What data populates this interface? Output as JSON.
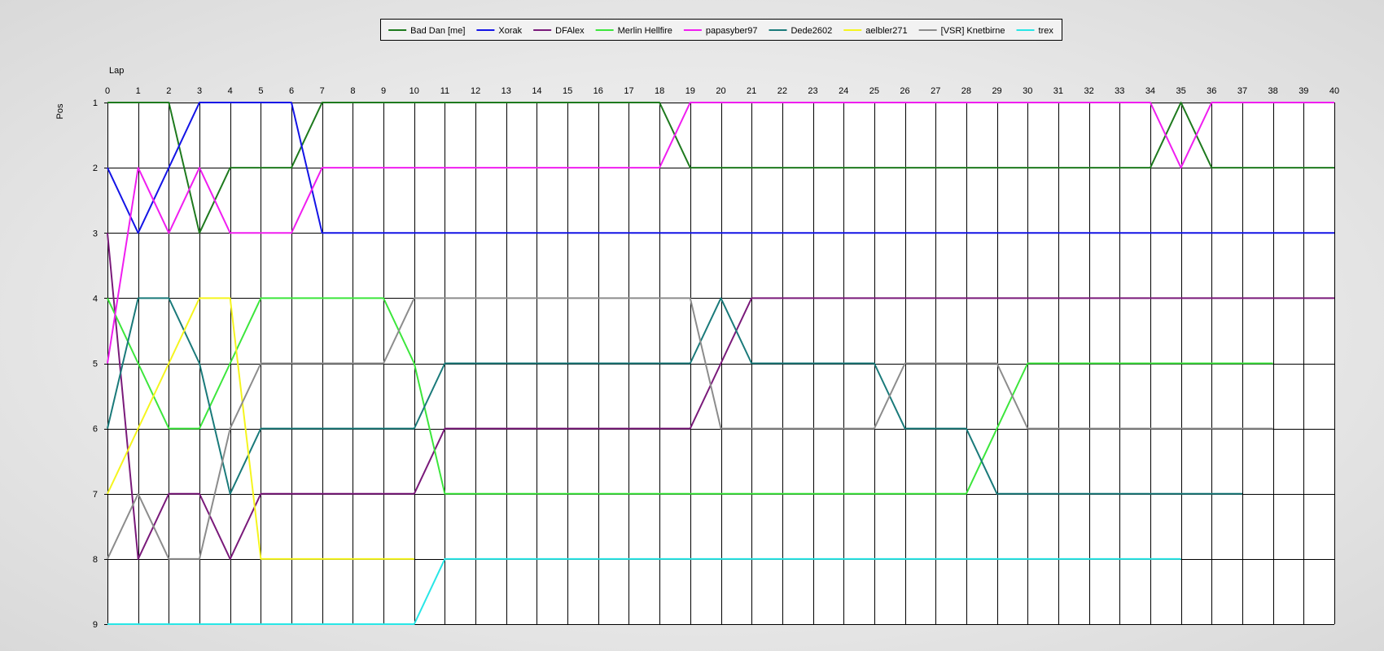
{
  "chart_data": {
    "type": "line",
    "xlabel": "Lap",
    "ylabel": "Pos",
    "xlim": [
      0,
      40
    ],
    "ylim": [
      1,
      9
    ],
    "y_inverted": true,
    "grid": true,
    "legend_position": "top-center",
    "x_ticks": [
      0,
      1,
      2,
      3,
      4,
      5,
      6,
      7,
      8,
      9,
      10,
      11,
      12,
      13,
      14,
      15,
      16,
      17,
      18,
      19,
      20,
      21,
      22,
      23,
      24,
      25,
      26,
      27,
      28,
      29,
      30,
      31,
      32,
      33,
      34,
      35,
      36,
      37,
      38,
      39,
      40
    ],
    "y_ticks": [
      1,
      2,
      3,
      4,
      5,
      6,
      7,
      8,
      9
    ],
    "series": [
      {
        "name": "Bad Dan [me]",
        "color": "#1e7a1e",
        "points": [
          [
            0,
            1
          ],
          [
            1,
            1
          ],
          [
            2,
            1
          ],
          [
            3,
            3
          ],
          [
            4,
            2
          ],
          [
            5,
            2
          ],
          [
            6,
            2
          ],
          [
            7,
            1
          ],
          [
            8,
            1
          ],
          [
            9,
            1
          ],
          [
            10,
            1
          ],
          [
            11,
            1
          ],
          [
            12,
            1
          ],
          [
            13,
            1
          ],
          [
            14,
            1
          ],
          [
            15,
            1
          ],
          [
            16,
            1
          ],
          [
            17,
            1
          ],
          [
            18,
            1
          ],
          [
            19,
            2
          ],
          [
            20,
            2
          ],
          [
            21,
            2
          ],
          [
            22,
            2
          ],
          [
            23,
            2
          ],
          [
            24,
            2
          ],
          [
            25,
            2
          ],
          [
            26,
            2
          ],
          [
            27,
            2
          ],
          [
            28,
            2
          ],
          [
            29,
            2
          ],
          [
            30,
            2
          ],
          [
            31,
            2
          ],
          [
            32,
            2
          ],
          [
            33,
            2
          ],
          [
            34,
            2
          ],
          [
            35,
            1
          ],
          [
            36,
            2
          ],
          [
            37,
            2
          ],
          [
            38,
            2
          ],
          [
            39,
            2
          ],
          [
            40,
            2
          ]
        ]
      },
      {
        "name": "Xorak",
        "color": "#1414e6",
        "points": [
          [
            0,
            2
          ],
          [
            1,
            3
          ],
          [
            2,
            2
          ],
          [
            3,
            1
          ],
          [
            4,
            1
          ],
          [
            5,
            1
          ],
          [
            6,
            1
          ],
          [
            7,
            3
          ],
          [
            8,
            3
          ],
          [
            9,
            3
          ],
          [
            10,
            3
          ],
          [
            11,
            3
          ],
          [
            12,
            3
          ],
          [
            13,
            3
          ],
          [
            14,
            3
          ],
          [
            15,
            3
          ],
          [
            16,
            3
          ],
          [
            17,
            3
          ],
          [
            18,
            3
          ],
          [
            19,
            3
          ],
          [
            20,
            3
          ],
          [
            21,
            3
          ],
          [
            22,
            3
          ],
          [
            23,
            3
          ],
          [
            24,
            3
          ],
          [
            25,
            3
          ],
          [
            26,
            3
          ],
          [
            27,
            3
          ],
          [
            28,
            3
          ],
          [
            29,
            3
          ],
          [
            30,
            3
          ],
          [
            31,
            3
          ],
          [
            32,
            3
          ],
          [
            33,
            3
          ],
          [
            34,
            3
          ],
          [
            35,
            3
          ],
          [
            36,
            3
          ],
          [
            37,
            3
          ],
          [
            38,
            3
          ],
          [
            39,
            3
          ],
          [
            40,
            3
          ]
        ]
      },
      {
        "name": "DFAlex",
        "color": "#7a1a7a",
        "points": [
          [
            0,
            3
          ],
          [
            1,
            8
          ],
          [
            2,
            7
          ],
          [
            3,
            7
          ],
          [
            4,
            8
          ],
          [
            5,
            7
          ],
          [
            6,
            7
          ],
          [
            7,
            7
          ],
          [
            8,
            7
          ],
          [
            9,
            7
          ],
          [
            10,
            7
          ],
          [
            11,
            6
          ],
          [
            12,
            6
          ],
          [
            13,
            6
          ],
          [
            14,
            6
          ],
          [
            15,
            6
          ],
          [
            16,
            6
          ],
          [
            17,
            6
          ],
          [
            18,
            6
          ],
          [
            19,
            6
          ],
          [
            20,
            5
          ],
          [
            21,
            4
          ],
          [
            22,
            4
          ],
          [
            23,
            4
          ],
          [
            24,
            4
          ],
          [
            25,
            4
          ],
          [
            26,
            4
          ],
          [
            27,
            4
          ],
          [
            28,
            4
          ],
          [
            29,
            4
          ],
          [
            30,
            4
          ],
          [
            31,
            4
          ],
          [
            32,
            4
          ],
          [
            33,
            4
          ],
          [
            34,
            4
          ],
          [
            35,
            4
          ],
          [
            36,
            4
          ],
          [
            37,
            4
          ],
          [
            38,
            4
          ],
          [
            39,
            4
          ],
          [
            40,
            4
          ]
        ]
      },
      {
        "name": "Merlin Hellfire",
        "color": "#3ce63c",
        "points": [
          [
            0,
            4
          ],
          [
            1,
            5
          ],
          [
            2,
            6
          ],
          [
            3,
            6
          ],
          [
            4,
            5
          ],
          [
            5,
            4
          ],
          [
            6,
            4
          ],
          [
            7,
            4
          ],
          [
            8,
            4
          ],
          [
            9,
            4
          ],
          [
            10,
            5
          ],
          [
            11,
            7
          ],
          [
            12,
            7
          ],
          [
            13,
            7
          ],
          [
            14,
            7
          ],
          [
            15,
            7
          ],
          [
            16,
            7
          ],
          [
            17,
            7
          ],
          [
            18,
            7
          ],
          [
            19,
            7
          ],
          [
            20,
            7
          ],
          [
            21,
            7
          ],
          [
            22,
            7
          ],
          [
            23,
            7
          ],
          [
            24,
            7
          ],
          [
            25,
            7
          ],
          [
            26,
            7
          ],
          [
            27,
            7
          ],
          [
            28,
            7
          ],
          [
            29,
            6
          ],
          [
            30,
            5
          ],
          [
            31,
            5
          ],
          [
            32,
            5
          ],
          [
            33,
            5
          ],
          [
            34,
            5
          ],
          [
            35,
            5
          ],
          [
            36,
            5
          ],
          [
            37,
            5
          ],
          [
            38,
            5
          ]
        ]
      },
      {
        "name": "papasyber97",
        "color": "#f01ef0",
        "points": [
          [
            0,
            5
          ],
          [
            1,
            2
          ],
          [
            2,
            3
          ],
          [
            3,
            2
          ],
          [
            4,
            3
          ],
          [
            5,
            3
          ],
          [
            6,
            3
          ],
          [
            7,
            2
          ],
          [
            8,
            2
          ],
          [
            9,
            2
          ],
          [
            10,
            2
          ],
          [
            11,
            2
          ],
          [
            12,
            2
          ],
          [
            13,
            2
          ],
          [
            14,
            2
          ],
          [
            15,
            2
          ],
          [
            16,
            2
          ],
          [
            17,
            2
          ],
          [
            18,
            2
          ],
          [
            19,
            1
          ],
          [
            20,
            1
          ],
          [
            21,
            1
          ],
          [
            22,
            1
          ],
          [
            23,
            1
          ],
          [
            24,
            1
          ],
          [
            25,
            1
          ],
          [
            26,
            1
          ],
          [
            27,
            1
          ],
          [
            28,
            1
          ],
          [
            29,
            1
          ],
          [
            30,
            1
          ],
          [
            31,
            1
          ],
          [
            32,
            1
          ],
          [
            33,
            1
          ],
          [
            34,
            1
          ],
          [
            35,
            2
          ],
          [
            36,
            1
          ],
          [
            37,
            1
          ],
          [
            38,
            1
          ],
          [
            39,
            1
          ],
          [
            40,
            1
          ]
        ]
      },
      {
        "name": "Dede2602",
        "color": "#1a7a7a",
        "points": [
          [
            0,
            6
          ],
          [
            1,
            4
          ],
          [
            2,
            4
          ],
          [
            3,
            5
          ],
          [
            4,
            7
          ],
          [
            5,
            6
          ],
          [
            6,
            6
          ],
          [
            7,
            6
          ],
          [
            8,
            6
          ],
          [
            9,
            6
          ],
          [
            10,
            6
          ],
          [
            11,
            5
          ],
          [
            12,
            5
          ],
          [
            13,
            5
          ],
          [
            14,
            5
          ],
          [
            15,
            5
          ],
          [
            16,
            5
          ],
          [
            17,
            5
          ],
          [
            18,
            5
          ],
          [
            19,
            5
          ],
          [
            20,
            4
          ],
          [
            21,
            5
          ],
          [
            22,
            5
          ],
          [
            23,
            5
          ],
          [
            24,
            5
          ],
          [
            25,
            5
          ],
          [
            26,
            6
          ],
          [
            27,
            6
          ],
          [
            28,
            6
          ],
          [
            29,
            7
          ],
          [
            30,
            7
          ],
          [
            31,
            7
          ],
          [
            32,
            7
          ],
          [
            33,
            7
          ],
          [
            34,
            7
          ],
          [
            35,
            7
          ],
          [
            36,
            7
          ],
          [
            37,
            7
          ]
        ]
      },
      {
        "name": "aelbler271",
        "color": "#f5f51e",
        "points": [
          [
            0,
            7
          ],
          [
            1,
            6
          ],
          [
            2,
            5
          ],
          [
            3,
            4
          ],
          [
            4,
            4
          ],
          [
            5,
            8
          ],
          [
            6,
            8
          ],
          [
            7,
            8
          ],
          [
            8,
            8
          ],
          [
            9,
            8
          ],
          [
            10,
            8
          ]
        ]
      },
      {
        "name": "[VSR] Knetbirne",
        "color": "#8c8c8c",
        "points": [
          [
            0,
            8
          ],
          [
            1,
            7
          ],
          [
            2,
            8
          ],
          [
            3,
            8
          ],
          [
            4,
            6
          ],
          [
            5,
            5
          ],
          [
            6,
            5
          ],
          [
            7,
            5
          ],
          [
            8,
            5
          ],
          [
            9,
            5
          ],
          [
            10,
            4
          ],
          [
            11,
            4
          ],
          [
            12,
            4
          ],
          [
            13,
            4
          ],
          [
            14,
            4
          ],
          [
            15,
            4
          ],
          [
            16,
            4
          ],
          [
            17,
            4
          ],
          [
            18,
            4
          ],
          [
            19,
            4
          ],
          [
            20,
            6
          ],
          [
            21,
            6
          ],
          [
            22,
            6
          ],
          [
            23,
            6
          ],
          [
            24,
            6
          ],
          [
            25,
            6
          ],
          [
            26,
            5
          ],
          [
            27,
            5
          ],
          [
            28,
            5
          ],
          [
            29,
            5
          ],
          [
            30,
            6
          ],
          [
            31,
            6
          ],
          [
            32,
            6
          ],
          [
            33,
            6
          ],
          [
            34,
            6
          ],
          [
            35,
            6
          ],
          [
            36,
            6
          ],
          [
            37,
            6
          ],
          [
            38,
            6
          ]
        ]
      },
      {
        "name": "trex",
        "color": "#28e6e6",
        "points": [
          [
            0,
            9
          ],
          [
            1,
            9
          ],
          [
            2,
            9
          ],
          [
            3,
            9
          ],
          [
            4,
            9
          ],
          [
            5,
            9
          ],
          [
            6,
            9
          ],
          [
            7,
            9
          ],
          [
            8,
            9
          ],
          [
            9,
            9
          ],
          [
            10,
            9
          ],
          [
            11,
            8
          ],
          [
            12,
            8
          ],
          [
            13,
            8
          ],
          [
            14,
            8
          ],
          [
            15,
            8
          ],
          [
            16,
            8
          ],
          [
            17,
            8
          ],
          [
            18,
            8
          ],
          [
            19,
            8
          ],
          [
            20,
            8
          ],
          [
            21,
            8
          ],
          [
            22,
            8
          ],
          [
            23,
            8
          ],
          [
            24,
            8
          ],
          [
            25,
            8
          ],
          [
            26,
            8
          ],
          [
            27,
            8
          ],
          [
            28,
            8
          ],
          [
            29,
            8
          ],
          [
            30,
            8
          ],
          [
            31,
            8
          ],
          [
            32,
            8
          ],
          [
            33,
            8
          ],
          [
            34,
            8
          ],
          [
            35,
            8
          ]
        ]
      }
    ]
  }
}
